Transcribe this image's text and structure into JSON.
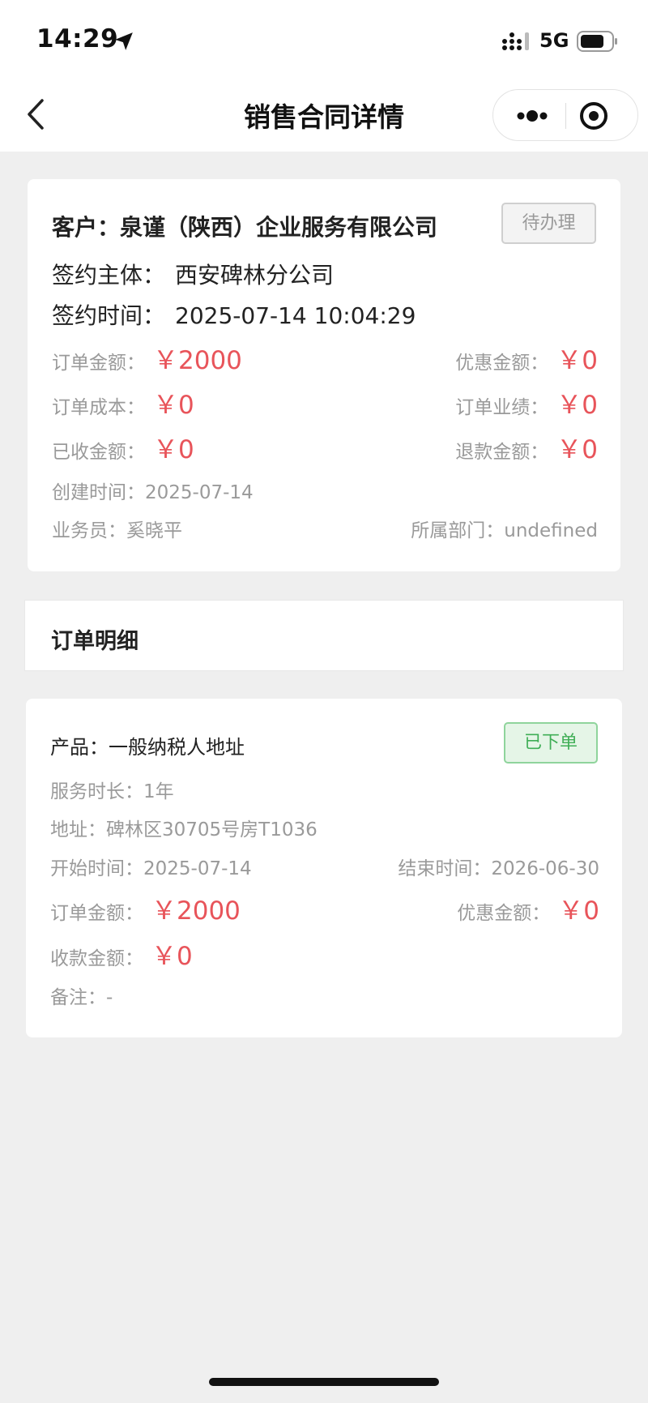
{
  "status_bar": {
    "time": "14:29",
    "network": "5G",
    "icons": [
      "location-arrow-icon",
      "signal-icon",
      "battery-icon"
    ]
  },
  "nav": {
    "title": "销售合同详情",
    "icons": [
      "back-chevron-icon",
      "more-dots-icon",
      "close-target-icon"
    ]
  },
  "contract": {
    "customer_label": "客户：",
    "customer": "泉谨（陕西）企业服务有限公司",
    "status": "待办理",
    "entity_label": "签约主体：",
    "entity": "西安碑林分公司",
    "sign_time_label": "签约时间：",
    "sign_time": "2025-07-14 10:04:29",
    "order_amount_label": "订单金额：",
    "order_amount": "￥2000",
    "discount_label": "优惠金额：",
    "discount": "￥0",
    "cost_label": "订单成本：",
    "cost": "￥0",
    "performance_label": "订单业绩：",
    "performance": "￥0",
    "received_label": "已收金额：",
    "received": "￥0",
    "refund_label": "退款金额：",
    "refund": "￥0",
    "created_label": "创建时间：",
    "created": "2025-07-14",
    "salesperson_label": "业务员：",
    "salesperson": "奚晓平",
    "department_label": "所属部门：",
    "department": "undefined"
  },
  "order_section": {
    "title": "订单明细"
  },
  "order_item": {
    "product_label": "产品：",
    "product": "一般纳税人地址",
    "status": "已下单",
    "duration_label": "服务时长：",
    "duration": "1年",
    "address_label": "地址：",
    "address": "碑林区30705号房T1036",
    "start_label": "开始时间：",
    "start": "2025-07-14",
    "end_label": "结束时间：",
    "end": "2026-06-30",
    "amount_label": "订单金额：",
    "amount": "￥2000",
    "discount_label": "优惠金额：",
    "discount": "￥0",
    "collected_label": "收款金额：",
    "collected": "￥0",
    "remark_label": "备注：",
    "remark": "-"
  },
  "colors": {
    "accent_red": "#e8545a",
    "status_green": "#3fae56",
    "muted_gray": "#9a9a9a",
    "background": "#efefef"
  }
}
